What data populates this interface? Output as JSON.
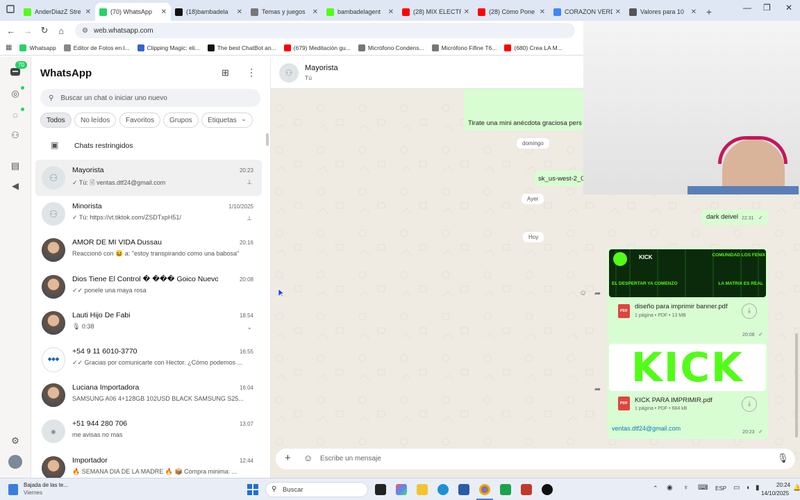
{
  "browser": {
    "tabs": [
      {
        "title": "AnderDiazZ Stre",
        "color": "#53fc18"
      },
      {
        "title": "(70) WhatsApp",
        "color": "#25d366",
        "active": true
      },
      {
        "title": "(18)bambadela",
        "color": "#111111"
      },
      {
        "title": "Temas y juegos",
        "color": "#777777"
      },
      {
        "title": "bambadelagent",
        "color": "#53fc18"
      },
      {
        "title": "(28) MIX ELECTR",
        "color": "#ff0000"
      },
      {
        "title": "(28) Cómo Pone",
        "color": "#ff0000"
      },
      {
        "title": "CORAZON VERD",
        "color": "#4285f4"
      },
      {
        "title": "Valores para 10",
        "color": "#555555"
      }
    ],
    "url": "web.whatsapp.com",
    "bookmarks": [
      {
        "label": "Whatsapp",
        "color": "#25d366"
      },
      {
        "label": "Editor de Fotos en l...",
        "color": "#888888"
      },
      {
        "label": "Clipping Magic: eli...",
        "color": "#3366cc"
      },
      {
        "label": "The best ChatBot an...",
        "color": "#111111"
      },
      {
        "label": "(679) Meditación gu...",
        "color": "#ff0000"
      },
      {
        "label": "Micrófono Condens...",
        "color": "#777777"
      },
      {
        "label": "Micrófono Fifine T6...",
        "color": "#777777"
      },
      {
        "label": "(680) Crea LA M...",
        "color": "#ff0000"
      }
    ]
  },
  "rail": {
    "badge": "70"
  },
  "sidebar": {
    "title": "WhatsApp",
    "search_placeholder": "Buscar un chat o iniciar uno nuevo",
    "filters": [
      "Todos",
      "No leídos",
      "Favoritos",
      "Grupos",
      "Etiquetas"
    ],
    "restricted": "Chats restringidos",
    "chats": [
      {
        "name": "Mayorista",
        "time": "20:23",
        "msg": "✓ Tú: 🗎 ventas.dtf24@gmail.com",
        "pinned": true,
        "selected": true,
        "avatar": "group"
      },
      {
        "name": "Minorista",
        "time": "1/10/2025",
        "msg": "✓ Tú: https://vt.tiktok.com/ZSDTxpH51/",
        "pinned": true,
        "avatar": "group"
      },
      {
        "name": "AMOR DE MI VIDA Dussau",
        "time": "20:16",
        "msg": "Reaccionó con 😆 a: \"estoy transpirando como una babosa\"",
        "avatar": "photo"
      },
      {
        "name": "Dios Tiene El Control � ��� Goico Nuevo...",
        "time": "20:08",
        "msg": "✓✓ ponele una maya rosa",
        "avatar": "photo"
      },
      {
        "name": "Lauti Hijo De Fabi",
        "time": "18:54",
        "msg": "🎙 0:38",
        "avatar": "photo",
        "chevron": true
      },
      {
        "name": "+54 9 11 6010-3770",
        "time": "16:55",
        "msg": "✓✓ Gracias por comunicarte con Hector. ¿Cómo podemos ...",
        "avatar": "logo"
      },
      {
        "name": "Luciana Importadora",
        "time": "16:04",
        "msg": "SAMSUNG A06 4+128GB 102USD BLACK    SAMSUNG S25...",
        "avatar": "photo"
      },
      {
        "name": "+51 944 280 706",
        "time": "13:07",
        "msg": "me avisas no mas",
        "avatar": "person"
      },
      {
        "name": "Importador",
        "time": "12:44",
        "msg": "🔥 SEMANA DIA DE LA MADRE 🔥 📦 Compra minima: ...",
        "avatar": "photo"
      }
    ]
  },
  "conversation": {
    "contact": "Mayorista",
    "subtitle": "Tú",
    "messages": {
      "anecdote": "Tirate una mini anécdota graciosa pers",
      "day_sunday": "domingo",
      "sk_text": "sk_us-west-2_0",
      "day_yesterday": "Ayer",
      "dark": "dark deivel",
      "dark_time": "22:31",
      "day_today": "Hoy",
      "file1_name": "diseño para imprimir banner.pdf",
      "file1_meta": "1 página • PDF • 13 MB",
      "file1_time": "20:08",
      "banner_left_top": "KICK",
      "banner_right_top": "COMUNIDAD LOS FENIX",
      "banner_left_bottom": "EL DESPERTAR YA COMENZO",
      "banner_right_bottom": "LA MATRIX ES REAL",
      "file2_name": "KICK PARA IMPRIMIR.pdf",
      "file2_meta": "1 página • PDF • 684 kB",
      "kick_logo": "KICK",
      "email": "ventas.dtf24@gmail.com",
      "email_time": "20:23"
    },
    "compose_placeholder": "Escribe un mensaje"
  },
  "taskbar": {
    "weather_title": "Bajada de las te...",
    "weather_sub": "Viernes",
    "search": "Buscar",
    "lang": "ESP",
    "time": "20:24",
    "date": "14/10/2025"
  },
  "colors": {
    "accent": "#25d366",
    "bubble": "#d9fdd3",
    "chat_bg": "#efeae2",
    "kick_green": "#53fc18",
    "pdf_red": "#e0443e"
  }
}
